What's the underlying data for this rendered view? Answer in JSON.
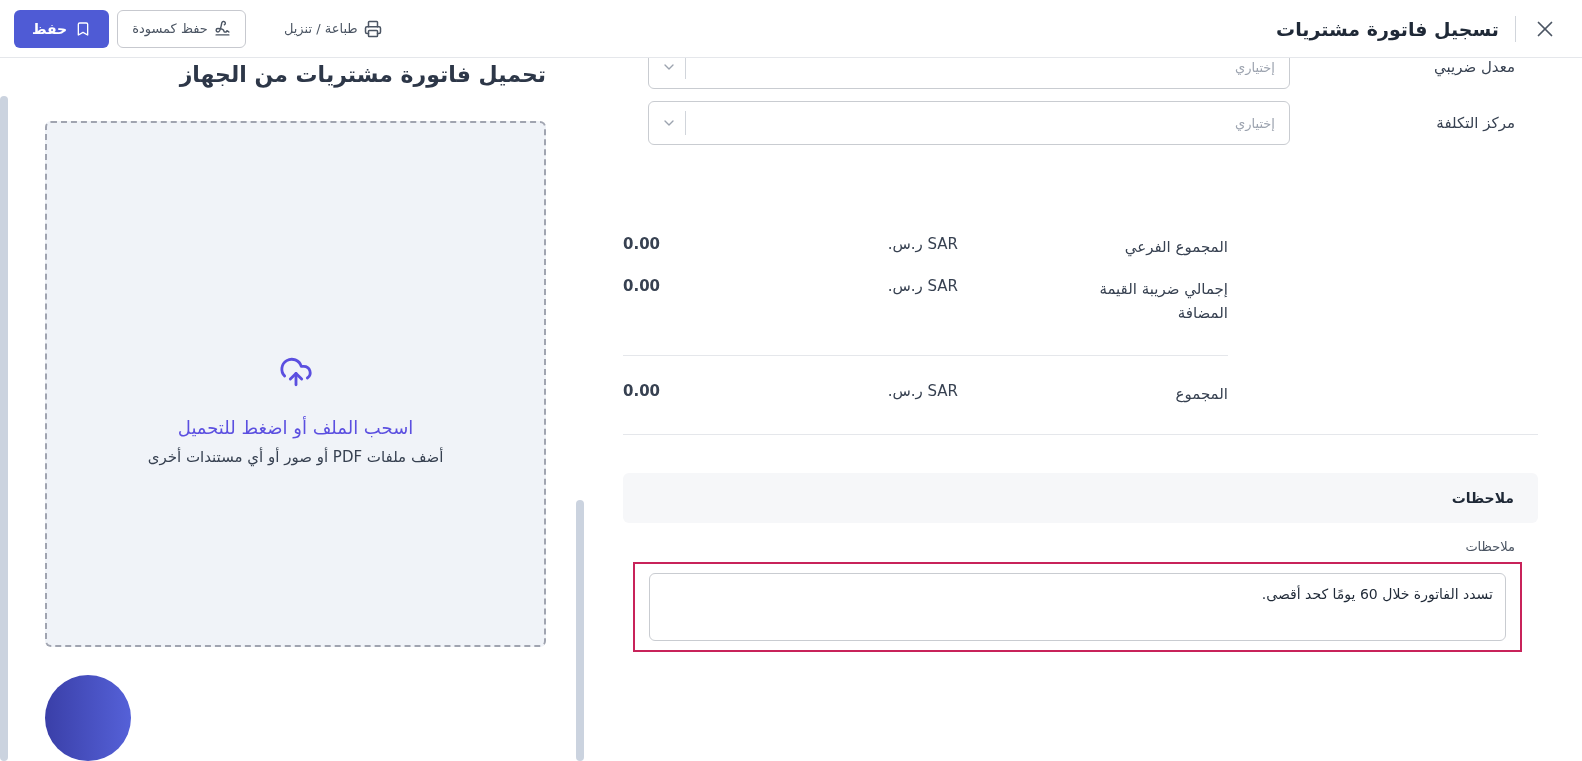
{
  "header": {
    "title": "تسجيل فاتورة مشتريات",
    "print_label": "طباعة / تنزيل",
    "draft_button": "حفظ كمسودة",
    "save_button": "حفظ"
  },
  "upload": {
    "title": "تحميل فاتورة مشتريات من الجهاز",
    "prompt": "اسحب الملف أو اضغط للتحميل",
    "hint": "أضف ملفات PDF أو صور أو أي مستندات أخرى"
  },
  "form_fields": [
    {
      "label": "معدل ضريبي",
      "placeholder": "إختياري"
    },
    {
      "label": "مركز التكلفة",
      "placeholder": "إختياري"
    }
  ],
  "totals": [
    {
      "kind": "line",
      "label": "المجموع الفرعي",
      "currency": "SAR ر.س.",
      "value": "0.00"
    },
    {
      "kind": "line",
      "label": "إجمالي ضريبة القيمة المضافة",
      "currency": "SAR ر.س.",
      "value": "0.00"
    },
    {
      "kind": "grand",
      "label": "المجموع",
      "currency": "SAR ر.س.",
      "value": "0.00"
    }
  ],
  "notes": {
    "section_title": "ملاحظات",
    "label": "ملاحظات",
    "value": "تسدد الفاتورة خلال 60 يومًا كحد أقصى.",
    "highlighted": true
  }
}
